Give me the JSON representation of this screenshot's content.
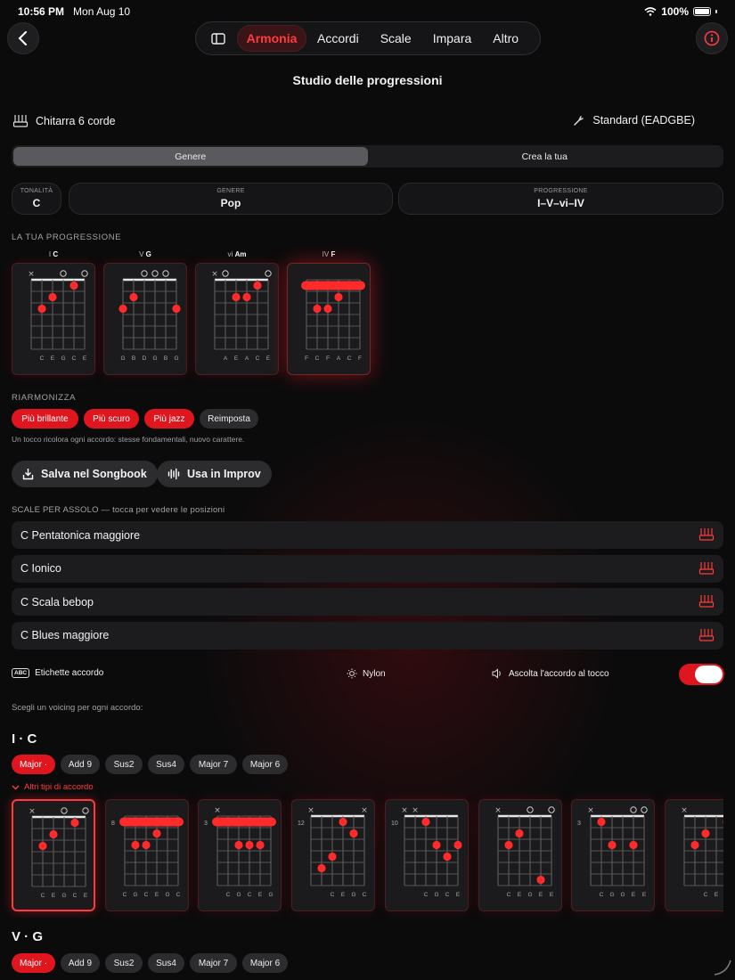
{
  "status": {
    "time": "10:56 PM",
    "date": "Mon Aug 10",
    "battery": "100%"
  },
  "nav": {
    "tabs": [
      "Armonia",
      "Accordi",
      "Scale",
      "Impara",
      "Altro"
    ],
    "active": "Armonia"
  },
  "title": "Studio delle progressioni",
  "instrument": "Chitarra 6 corde",
  "tuning": "Standard (EADGBE)",
  "mode": {
    "options": [
      "Genere",
      "Crea la tua"
    ],
    "active": "Genere"
  },
  "selectors": {
    "key": {
      "label": "TONALITÀ",
      "value": "C"
    },
    "genre": {
      "label": "GENERE",
      "value": "Pop"
    },
    "progression": {
      "label": "PROGRESSIONE",
      "value": "I–V–vi–IV"
    }
  },
  "progression_label": "LA TUA PROGRESSIONE",
  "progression_chords": [
    {
      "degree": "I",
      "name": "C",
      "top": [
        "x",
        "",
        "",
        "o",
        "",
        "o"
      ],
      "notes": [
        "C",
        "E",
        "G",
        "C",
        "E"
      ],
      "dots": [
        [
          1,
          3,
          1
        ],
        [
          2,
          2,
          1
        ],
        [
          4,
          1,
          1
        ]
      ],
      "barre": null
    },
    {
      "degree": "V",
      "name": "G",
      "top": [
        "",
        "",
        "o",
        "o",
        "o",
        ""
      ],
      "notes": [
        "G",
        "B",
        "D",
        "G",
        "B",
        "G"
      ],
      "dots": [
        [
          0,
          3,
          1
        ],
        [
          1,
          2,
          1
        ],
        [
          5,
          3,
          1
        ]
      ],
      "barre": null
    },
    {
      "degree": "vi",
      "name": "Am",
      "top": [
        "x",
        "o",
        "",
        "",
        "",
        "o"
      ],
      "notes": [
        "A",
        "E",
        "A",
        "C",
        "E"
      ],
      "dots": [
        [
          2,
          2,
          1
        ],
        [
          3,
          2,
          1
        ],
        [
          4,
          1,
          1
        ]
      ],
      "barre": null
    },
    {
      "degree": "IV",
      "name": "F",
      "top": [
        "",
        "",
        "",
        "",
        "",
        ""
      ],
      "notes": [
        "F",
        "C",
        "F",
        "A",
        "C",
        "F"
      ],
      "dots": [
        [
          1,
          3,
          1
        ],
        [
          2,
          3,
          1
        ],
        [
          3,
          2,
          1
        ]
      ],
      "barre": 1
    }
  ],
  "reharm": {
    "label": "RIARMONIZZA",
    "buttons": [
      "Più brillante",
      "Più scuro",
      "Più jazz",
      "Reimposta"
    ],
    "hint": "Un tocco ricolora ogni accordo: stesse fondamentali, nuovo carattere."
  },
  "actions": {
    "save": "Salva nel Songbook",
    "improv": "Usa in Improv"
  },
  "scales": {
    "label": "SCALE PER ASSOLO — tocca per vedere le posizioni",
    "items": [
      "C Pentatonica maggiore",
      "C Ionico",
      "C Scala bebop",
      "C Blues maggiore"
    ]
  },
  "options": {
    "labels": "Etichette accordo",
    "labels_badge": "ABC",
    "sound": "Nylon",
    "listen": "Ascolta l'accordo al tocco",
    "listen_on": true
  },
  "voicing_hint": "Scegli un voicing per ogni accordo:",
  "groups": [
    {
      "title": "I · C",
      "types": [
        "Major ·",
        "Add 9",
        "Sus2",
        "Sus4",
        "Major 7",
        "Major 6"
      ],
      "active_type": "Major ·",
      "more": "Altri tipi di accordo"
    },
    {
      "title": "V · G",
      "types": [
        "Major ·",
        "Add 9",
        "Sus2",
        "Sus4",
        "Major 7",
        "Major 6"
      ],
      "active_type": "Major ·"
    }
  ],
  "voicings": [
    {
      "fret": "",
      "top": [
        "x",
        "",
        "",
        "o",
        "",
        "o"
      ],
      "notes": [
        "C",
        "E",
        "G",
        "C",
        "E"
      ],
      "dots": [
        [
          1,
          3,
          1
        ],
        [
          2,
          2,
          1
        ],
        [
          4,
          1,
          1
        ]
      ],
      "barre": null,
      "selected": true
    },
    {
      "fret": "8",
      "top": [
        "",
        "",
        "",
        "",
        "",
        ""
      ],
      "notes": [
        "C",
        "G",
        "C",
        "E",
        "G",
        "C"
      ],
      "dots": [
        [
          1,
          3,
          1
        ],
        [
          2,
          3,
          1
        ],
        [
          3,
          2,
          1
        ]
      ],
      "barre": 1
    },
    {
      "fret": "3",
      "top": [
        "x",
        "",
        "",
        "",
        "",
        ""
      ],
      "notes": [
        "C",
        "G",
        "C",
        "E",
        "G"
      ],
      "dots": [
        [
          2,
          3,
          1
        ],
        [
          3,
          3,
          1
        ],
        [
          4,
          3,
          1
        ]
      ],
      "barre": 1
    },
    {
      "fret": "12",
      "top": [
        "x",
        "",
        "",
        "",
        "",
        "x"
      ],
      "notes": [
        "C",
        "E",
        "G",
        "C"
      ],
      "dots": [
        [
          1,
          5,
          1
        ],
        [
          2,
          4,
          1
        ],
        [
          3,
          1,
          1
        ],
        [
          4,
          2,
          1
        ]
      ],
      "barre": null
    },
    {
      "fret": "10",
      "top": [
        "x",
        "x",
        "",
        "",
        "",
        ""
      ],
      "notes": [
        "C",
        "G",
        "C",
        "E"
      ],
      "dots": [
        [
          2,
          1,
          1
        ],
        [
          3,
          3,
          1
        ],
        [
          4,
          4,
          1
        ],
        [
          5,
          3,
          1
        ]
      ],
      "barre": null
    },
    {
      "fret": "",
      "top": [
        "x",
        "",
        "",
        "o",
        "",
        "o"
      ],
      "notes": [
        "C",
        "E",
        "G",
        "E",
        "E"
      ],
      "dots": [
        [
          1,
          3,
          1
        ],
        [
          2,
          2,
          1
        ],
        [
          4,
          6,
          1
        ]
      ],
      "barre": null
    },
    {
      "fret": "3",
      "top": [
        "x",
        "",
        "",
        "",
        "o",
        "o"
      ],
      "notes": [
        "C",
        "G",
        "G",
        "E",
        "E"
      ],
      "dots": [
        [
          1,
          1,
          1
        ],
        [
          2,
          3,
          1
        ],
        [
          4,
          3,
          1
        ]
      ],
      "barre": null
    },
    {
      "fret": "",
      "top": [
        "x",
        "",
        "",
        "",
        "o",
        ""
      ],
      "notes": [
        "C",
        "E",
        "G",
        "C"
      ],
      "dots": [
        [
          1,
          3,
          1
        ],
        [
          2,
          2,
          1
        ],
        [
          4,
          1,
          1
        ]
      ],
      "barre": null
    }
  ],
  "colors": {
    "accent": "#ff3b3b",
    "accent_fill": "#e0161f",
    "bg": "#0b0b0c",
    "surface": "#1c1c1e"
  },
  "icons": {
    "back": "chevron-left-icon",
    "sidebar": "sidebar-icon",
    "info": "info-icon",
    "instrument": "guitar-icon",
    "tuning": "tuning-fork-icon",
    "save": "download-icon",
    "improv": "waveform-icon",
    "scale": "fretboard-icon",
    "sound": "sun-icon",
    "speaker": "speaker-icon"
  }
}
